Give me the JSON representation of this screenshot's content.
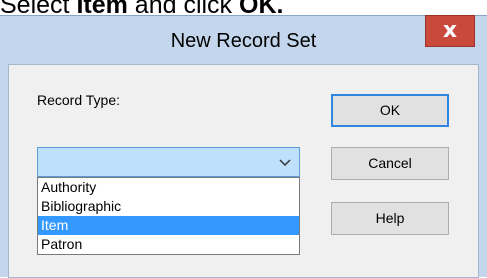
{
  "instruction": {
    "text_before": "Select ",
    "bold_item": "Item",
    "text_middle": " and click ",
    "bold_ok": "OK."
  },
  "dialog": {
    "title": "New Record Set",
    "close_symbol": "x",
    "record_type_label": "Record Type:",
    "record_type_value": "",
    "options": [
      "Authority",
      "Bibliographic",
      "Item",
      "Patron"
    ],
    "selected_option": "Item",
    "buttons": {
      "ok": "OK",
      "cancel": "Cancel",
      "help": "Help"
    }
  },
  "colors": {
    "frame": "#c3d6ec",
    "close_button": "#c9493c",
    "selection": "#3399ff",
    "select_box": "#bfe0fb"
  }
}
